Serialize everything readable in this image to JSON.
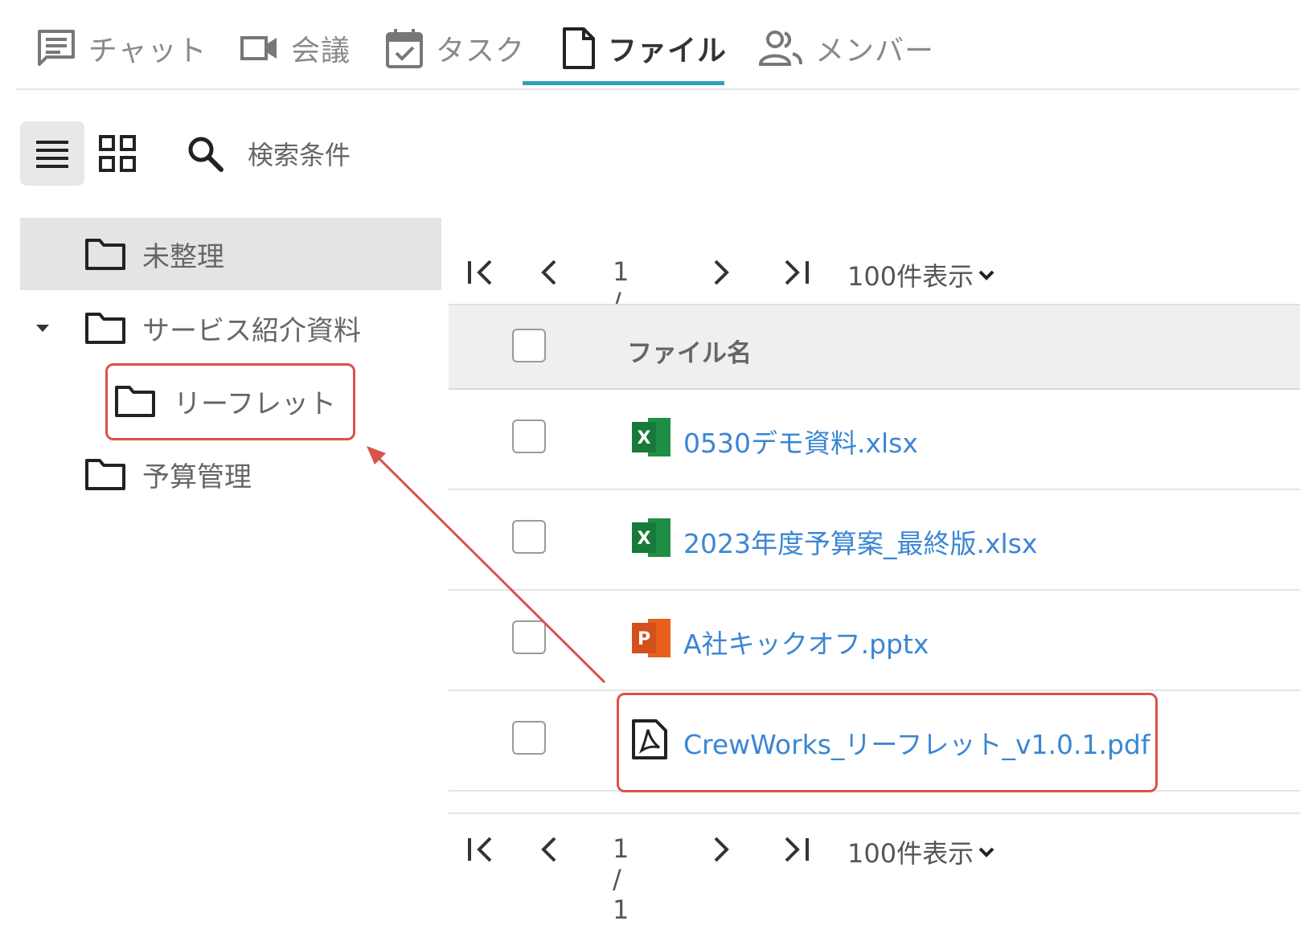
{
  "tabs": [
    {
      "label": "チャット",
      "icon": "chat-icon"
    },
    {
      "label": "会議",
      "icon": "video-icon"
    },
    {
      "label": "タスク",
      "icon": "calendar-check-icon"
    },
    {
      "label": "ファイル",
      "icon": "file-icon",
      "active": true
    },
    {
      "label": "メンバー",
      "icon": "members-icon"
    }
  ],
  "toolbar": {
    "list_view": "list-icon",
    "grid_view": "grid-icon",
    "search_label": "検索条件"
  },
  "folders": [
    {
      "label": "未整理",
      "selected": true
    },
    {
      "label": "サービス紹介資料",
      "expanded": true
    },
    {
      "label": "リーフレット",
      "child": true
    },
    {
      "label": "予算管理"
    }
  ],
  "pager": {
    "page_text": "1 / 1",
    "per_page": "100件表示"
  },
  "list": {
    "column_header": "ファイル名",
    "files": [
      {
        "name": "0530デモ資料.xlsx",
        "icon": "excel-icon"
      },
      {
        "name": "2023年度予算案_最終版.xlsx",
        "icon": "excel-icon"
      },
      {
        "name": "A社キックオフ.pptx",
        "icon": "powerpoint-icon"
      },
      {
        "name": "CrewWorks_リーフレット_v1.0.1.pdf",
        "icon": "pdf-icon"
      }
    ]
  },
  "colors": {
    "accent": "#2fa0bd",
    "link": "#3b86d4",
    "annotation": "#d9534a",
    "excel": "#1f8f45",
    "powerpoint": "#e8611c"
  }
}
